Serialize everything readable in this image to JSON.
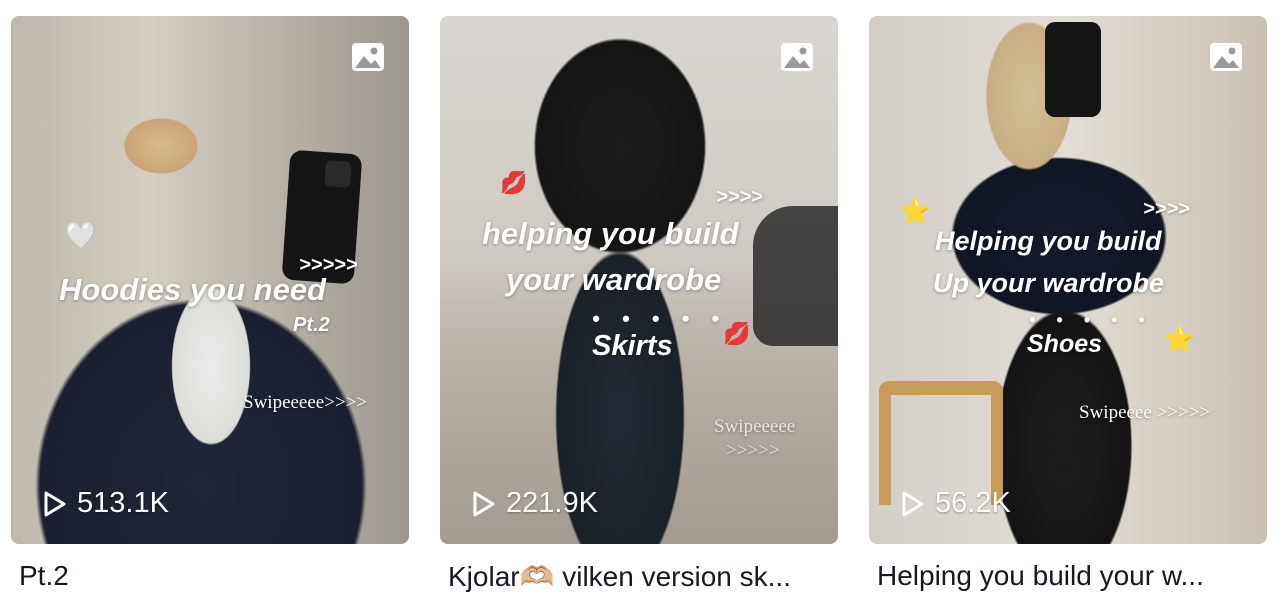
{
  "videos": [
    {
      "overlay_title": "Hoodies you need",
      "overlay_sub": "Pt.2",
      "overlay_arrows": ">>>>>",
      "overlay_swipe": "Swipeeeee>>>>",
      "play_count": "513.1K",
      "caption": "Pt.2"
    },
    {
      "overlay_arrows": ">>>>",
      "overlay_line1": "helping you build",
      "overlay_line2": "your wardrobe",
      "overlay_dots": "• • • • •",
      "overlay_line3": "Skirts",
      "overlay_swipe1": "Swipeeeee",
      "overlay_swipe2": ">>>>>",
      "play_count": "221.9K",
      "caption": "Kjolar🫶🏼 vilken version sk..."
    },
    {
      "overlay_arrows": ">>>>",
      "overlay_line1": "Helping you build",
      "overlay_line2": "Up your wardrobe",
      "overlay_dots": "• • • • •",
      "overlay_line3": "Shoes",
      "overlay_swipe": "Swipeeee >>>>>",
      "play_count": "56.2K",
      "caption": "Helping you build your w..."
    }
  ],
  "icons": {
    "gallery": "image-icon",
    "play": "play-icon"
  },
  "colors": {
    "caption_text": "#161823",
    "overlay_text": "#ffffff"
  }
}
